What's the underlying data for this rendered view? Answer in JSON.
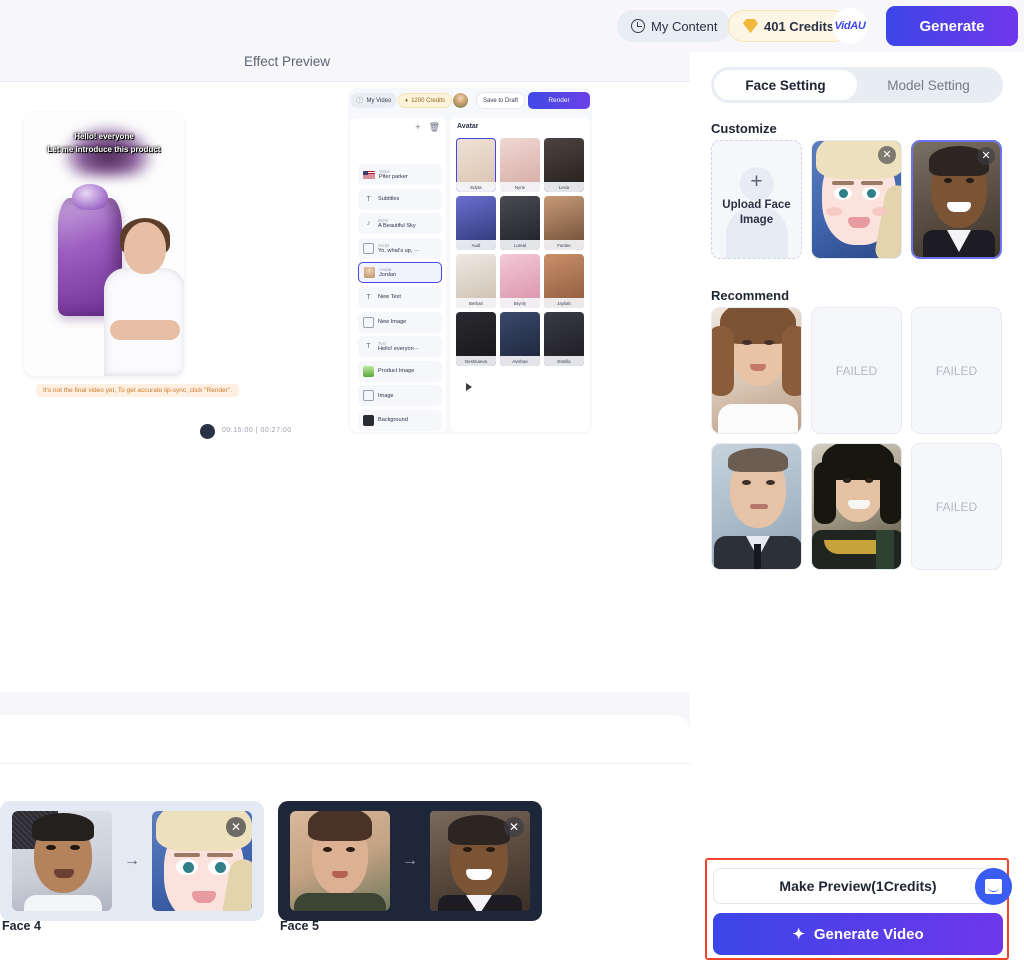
{
  "topbar": {
    "my_content_label": "My Content",
    "my_content_icon": "clock-icon",
    "credits_label": "401 Credits",
    "credits_icon": "gem-icon",
    "brand_logo": "VidAU",
    "generate_label": "Generate"
  },
  "preview": {
    "section_title": "Effect Preview",
    "video": {
      "subtitle_line1": "Hello! everyone",
      "subtitle_line2": "Let me introduce this product",
      "warning": "It's not the final video yet, To get accurate lip-sync, click \"Render\".",
      "timecode": "00:15:00  |  00:27:00"
    },
    "editor_mock": {
      "my_video_label": "My Video",
      "credits_label": "1200 Credits",
      "save_draft_label": "Save to Draft",
      "render_label": "Render",
      "panel_title": "Avatar",
      "sidebar_items": [
        {
          "kind": "Voice",
          "label": "Piter parker",
          "icon": "flag-icon"
        },
        {
          "kind": "",
          "label": "Subtitles",
          "icon": "text-icon"
        },
        {
          "kind": "BGM",
          "label": "A Beautiful Sky",
          "icon": "music-icon"
        },
        {
          "kind": "Script",
          "label": "Yo, what's up, ···",
          "icon": "script-icon"
        },
        {
          "kind": "Avatar",
          "label": "Jordan",
          "icon": "avatar-icon"
        },
        {
          "kind": "",
          "label": "New Text",
          "icon": "text-icon"
        },
        {
          "kind": "",
          "label": "New Image",
          "icon": "image-icon"
        },
        {
          "kind": "Text",
          "label": "Hello! everyon···",
          "icon": "text-icon"
        },
        {
          "kind": "",
          "label": "Product Image",
          "icon": "product-icon"
        },
        {
          "kind": "",
          "label": "Image",
          "icon": "image-icon"
        },
        {
          "kind": "",
          "label": "Background",
          "icon": "background-icon"
        }
      ],
      "avatar_names": [
        "Edyta",
        "Nyrie",
        "Lexia",
        "Audi",
        "Loreal",
        "Famke",
        "Bethari",
        "Brynly",
        "Jayliah",
        "Destinaeva",
        "Avishae",
        "Estella"
      ]
    }
  },
  "face_pairs": {
    "items": [
      {
        "label": "",
        "source_name": "woman-sunglasses",
        "target_name": "",
        "cut_off": true
      },
      {
        "label": "Face 4",
        "source_name": "man-portrait",
        "target_name": "elsa-cartoon",
        "cut_off": false
      },
      {
        "label": "Face 5",
        "source_name": "woman-portrait",
        "target_name": "obama-portrait",
        "cut_off": false
      }
    ],
    "arrow_glyph": "→",
    "close_glyph": "✕"
  },
  "right_panel": {
    "tabs": [
      {
        "label": "Face Setting",
        "active": true
      },
      {
        "label": "Model Setting",
        "active": false
      }
    ],
    "customize": {
      "title": "Customize",
      "upload": {
        "plus_glyph": "+",
        "label_line1": "Upload Face",
        "label_line2": "Image"
      },
      "faces": [
        {
          "name": "elsa-cartoon",
          "selected": false,
          "has_close": true
        },
        {
          "name": "obama-portrait",
          "selected": true,
          "has_close": true
        }
      ]
    },
    "recommend": {
      "title": "Recommend",
      "items": [
        {
          "name": "woman-model",
          "state": "ok"
        },
        {
          "name": "slot-2",
          "state": "failed",
          "label": "FAILED"
        },
        {
          "name": "slot-3",
          "state": "failed",
          "label": "FAILED"
        },
        {
          "name": "elon-musk",
          "state": "ok"
        },
        {
          "name": "loki",
          "state": "ok"
        },
        {
          "name": "slot-6",
          "state": "failed",
          "label": "FAILED"
        }
      ]
    },
    "actions": {
      "make_preview_label": "Make Preview(1Credits)",
      "generate_video_label": "Generate Video",
      "generate_video_icon": "sparkle-icon",
      "highlight_color": "#f0452a"
    }
  },
  "chat_widget": {
    "name": "intercom-chat-button"
  },
  "colors": {
    "accent_blue": "#3b46e8",
    "accent_purple": "#7137ec",
    "page_bg": "#f7f7fb",
    "panel_bg": "#ffffff",
    "highlight_red": "#f0452a",
    "credits_bg": "#fdf6e4"
  }
}
